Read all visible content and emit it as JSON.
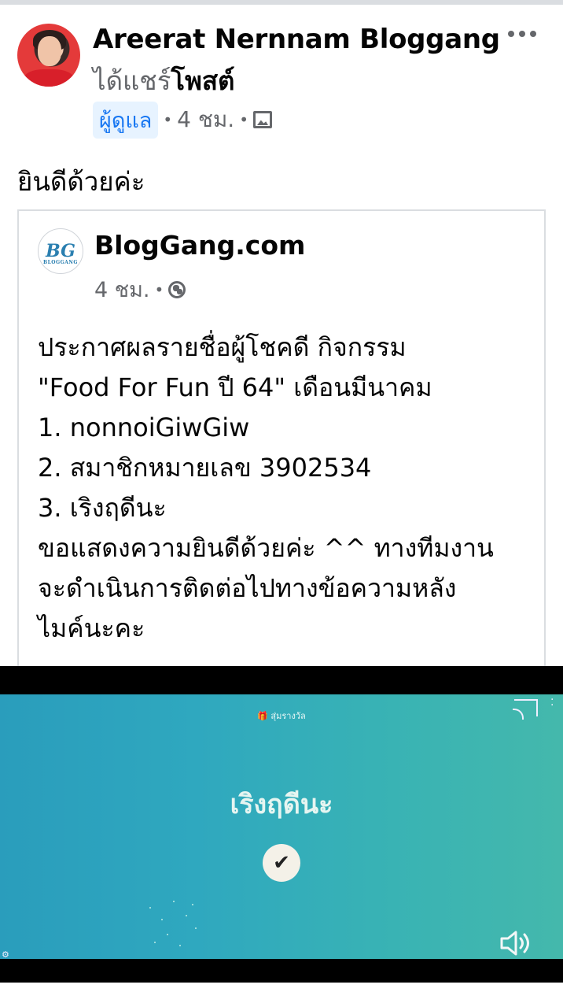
{
  "post": {
    "author_name": "Areerat Nernnam Bloggang",
    "shared_prefix": "ได้แชร์",
    "shared_object": "โพสต์",
    "admin_badge": "ผู้ดูแล",
    "time": "4 ชม.",
    "separator": "•",
    "text": "ยินดีด้วยค่ะ"
  },
  "shared_card": {
    "page_name": "BlogGang.com",
    "logo_text": "BG",
    "logo_subtext": "BLOGGANG",
    "time": "4 ชม.",
    "separator": "•",
    "body_lines": [
      "ประกาศผลรายชื่อผู้โชคดี กิจกรรม",
      "\"Food For Fun ปี 64\" เดือนมีนาคม",
      "1. nonnoiGiwGiw",
      "2. สมาชิกหมายเลข 3902534",
      "3. เริงฤดีนะ",
      "ขอแสดงความยินดีด้วยค่ะ ^^ ทางทีมงาน",
      "จะดำเนินการติดต่อไปทางข้อความหลัง",
      "ไมค์นะคะ"
    ]
  },
  "video": {
    "header_label": "สุ่มรางวัล",
    "winner_name": "เริงฤดีนะ",
    "check_symbol": "✔",
    "icons": [
      "cast-icon",
      "more-vertical-icon",
      "volume-icon",
      "gear-icon",
      "gift-icon"
    ]
  },
  "colors": {
    "admin_badge_bg": "#e7f3ff",
    "admin_badge_text": "#1877f2",
    "video_bg_start": "#2a9dbc",
    "video_bg_end": "#44b8ac"
  }
}
